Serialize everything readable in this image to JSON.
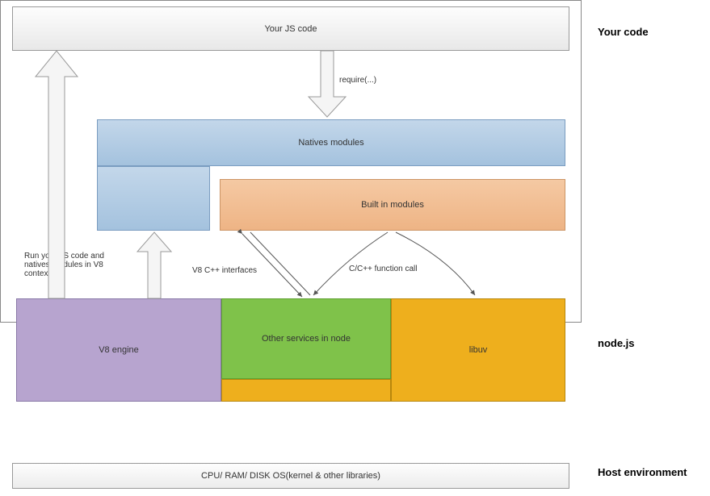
{
  "sections": {
    "your_code": "Your code",
    "nodejs": "node.js",
    "host_env": "Host environment"
  },
  "boxes": {
    "your_js_code": "Your JS code",
    "natives_modules": "Natives modules",
    "builtin_modules": "Built in modules",
    "v8_engine": "V8 engine",
    "other_services": "Other services in node",
    "libuv": "libuv",
    "host_env_box": "CPU/ RAM/ DISK   OS(kernel & other libraries)"
  },
  "edges": {
    "require": "require(...)",
    "run_context": "Run your JS code and natives modules in V8 context",
    "v8_c_interfaces": "V8 C++ interfaces",
    "c_func_call": "C/C++ function call"
  }
}
